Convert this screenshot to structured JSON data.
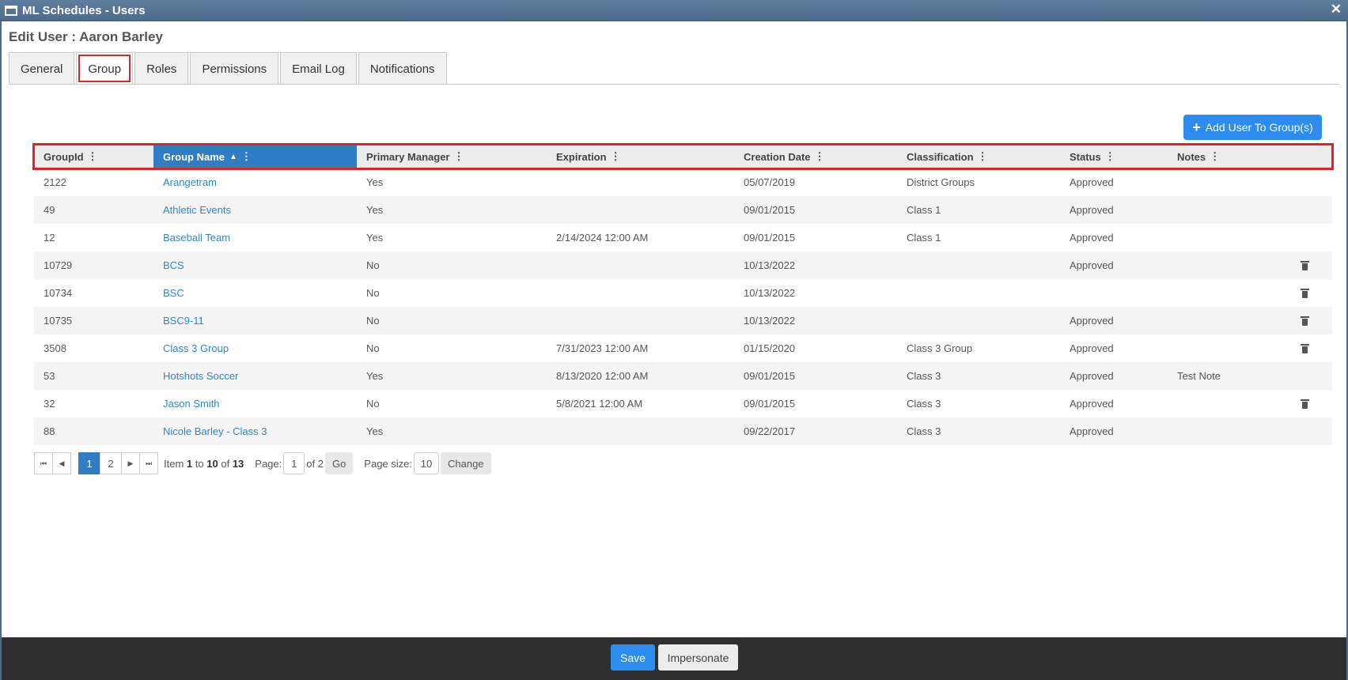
{
  "window": {
    "title": "ML Schedules - Users",
    "close": "✕"
  },
  "page_title": "Edit User : Aaron Barley",
  "tabs": [
    {
      "label": "General"
    },
    {
      "label": "Group"
    },
    {
      "label": "Roles"
    },
    {
      "label": "Permissions"
    },
    {
      "label": "Email Log"
    },
    {
      "label": "Notifications"
    }
  ],
  "active_tab": "Group",
  "add_button": {
    "plus": "+",
    "label": "Add User To Group(s)"
  },
  "columns": [
    {
      "label": "GroupId"
    },
    {
      "label": "Group Name",
      "sort": "▲"
    },
    {
      "label": "Primary Manager"
    },
    {
      "label": "Expiration"
    },
    {
      "label": "Creation Date"
    },
    {
      "label": "Classification"
    },
    {
      "label": "Status"
    },
    {
      "label": "Notes"
    }
  ],
  "rows": [
    [
      "2122",
      "Arangetram",
      "Yes",
      "",
      "05/07/2019",
      "District Groups",
      "Approved",
      ""
    ],
    [
      "49",
      "Athletic Events",
      "Yes",
      "",
      "09/01/2015",
      "Class 1",
      "Approved",
      ""
    ],
    [
      "12",
      "Baseball Team",
      "Yes",
      "2/14/2024 12:00 AM",
      "09/01/2015",
      "Class 1",
      "Approved",
      ""
    ],
    [
      "10729",
      "BCS",
      "No",
      "",
      "10/13/2022",
      "",
      "Approved",
      ""
    ],
    [
      "10734",
      "BSC",
      "No",
      "",
      "10/13/2022",
      "",
      "",
      ""
    ],
    [
      "10735",
      "BSC9-11",
      "No",
      "",
      "10/13/2022",
      "",
      "Approved",
      ""
    ],
    [
      "3508",
      "Class 3 Group",
      "No",
      "7/31/2023 12:00 AM",
      "01/15/2020",
      "Class 3 Group",
      "Approved",
      ""
    ],
    [
      "53",
      "Hotshots Soccer",
      "Yes",
      "8/13/2020 12:00 AM",
      "09/01/2015",
      "Class 3",
      "Approved",
      "Test Note"
    ],
    [
      "32",
      "Jason Smith",
      "No",
      "5/8/2021 12:00 AM",
      "09/01/2015",
      "Class 3",
      "Approved",
      ""
    ],
    [
      "88",
      "Nicole Barley - Class 3",
      "Yes",
      "",
      "09/22/2017",
      "Class 3",
      "Approved",
      ""
    ]
  ],
  "row_trash": [
    false,
    false,
    false,
    true,
    true,
    true,
    true,
    false,
    true,
    false
  ],
  "pager": {
    "pages": [
      "1",
      "2"
    ],
    "current": "1",
    "item_prefix": "Item",
    "from": "1",
    "to_word": "to",
    "to": "10",
    "of_word": "of",
    "total": "13",
    "page_label": "Page:",
    "page_value": "1",
    "of_pages": "of 2",
    "go_label": "Go",
    "size_label": "Page size:",
    "size_value": "10",
    "change_label": "Change"
  },
  "footer": {
    "save_label": "Save",
    "impersonate_label": "Impersonate"
  },
  "colors": {
    "accent": "#2d8cf0",
    "sorted_header": "#2f7dc2",
    "link": "#2e86d4",
    "highlight": "#e02424"
  }
}
